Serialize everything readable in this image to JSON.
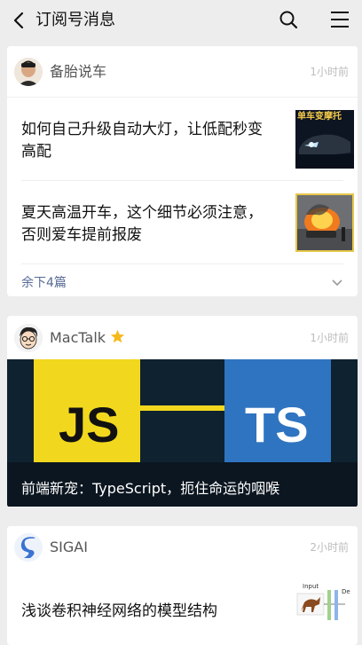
{
  "header": {
    "title": "订阅号消息"
  },
  "cards": [
    {
      "account": "备胎说车",
      "time": "1小时前",
      "articles": [
        {
          "title": "如何自己升级自动大灯，让低配秒变高配",
          "thumb_text": "单车变摩托"
        },
        {
          "title": "夏天高温开车，这个细节必须注意，否则爱车提前报废"
        }
      ],
      "more": "余下4篇"
    },
    {
      "account": "MacTalk",
      "time": "1小时前",
      "banner_caption": "前端新宠：TypeScript，扼住命运的咽喉",
      "banner_left": "JS",
      "banner_right": "TS"
    },
    {
      "account": "SIGAI",
      "time": "2小时前",
      "articles": [
        {
          "title": "浅谈卷积神经网络的模型结构",
          "thumb_input": "Input",
          "thumb_de": "De"
        }
      ]
    }
  ],
  "colors": {
    "background": "#ededed",
    "link": "#576b95",
    "js": "#f1d81e",
    "ts": "#2f74c0",
    "star": "#f6b91b"
  }
}
